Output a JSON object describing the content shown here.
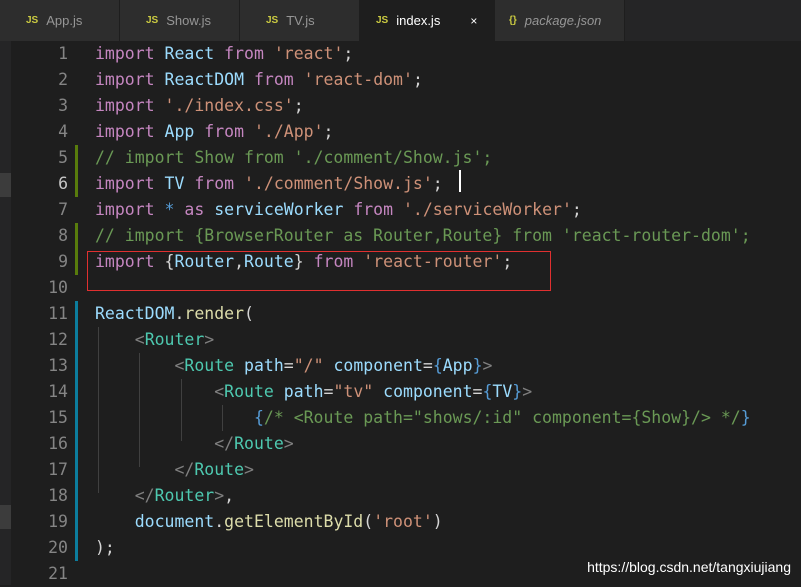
{
  "tabs": [
    {
      "icon": "JS",
      "label": "App.js"
    },
    {
      "icon": "JS",
      "label": "Show.js"
    },
    {
      "icon": "JS",
      "label": "TV.js"
    },
    {
      "icon": "JS",
      "label": "index.js",
      "close": "×"
    },
    {
      "icon": "{}",
      "label": "package.json"
    }
  ],
  "line_numbers": [
    "1",
    "2",
    "3",
    "4",
    "5",
    "6",
    "7",
    "8",
    "9",
    "10",
    "11",
    "12",
    "13",
    "14",
    "15",
    "16",
    "17",
    "18",
    "19",
    "20",
    "21"
  ],
  "code": {
    "l1": [
      "import",
      "React",
      "from",
      "'react'",
      ";"
    ],
    "l2": [
      "import",
      "ReactDOM",
      "from",
      "'react-dom'",
      ";"
    ],
    "l3": [
      "import",
      "'./index.css'",
      ";"
    ],
    "l4": [
      "import",
      "App",
      "from",
      "'./App'",
      ";"
    ],
    "l5": [
      "// import Show from './comment/Show.js';"
    ],
    "l6": [
      "import",
      "TV",
      "from",
      "'./comment/Show.js'",
      ";"
    ],
    "l7": [
      "import",
      "*",
      "as",
      "serviceWorker",
      "from",
      "'./serviceWorker'",
      ";"
    ],
    "l8": [
      "// import {BrowserRouter as Router,Route} from 'react-router-dom';"
    ],
    "l9": [
      "import",
      "{",
      "Router",
      ",",
      "Route",
      "}",
      "from",
      "'react-router'",
      ";"
    ],
    "l11": [
      "ReactDOM",
      ".",
      "render",
      "("
    ],
    "l12": [
      "<",
      "Router",
      ">"
    ],
    "l13": [
      "<",
      "Route",
      "path",
      "=",
      "\"/\"",
      "component",
      "=",
      "{",
      "App",
      "}",
      ">"
    ],
    "l14": [
      "<",
      "Route",
      "path",
      "=",
      "\"tv\"",
      "component",
      "=",
      "{",
      "TV",
      "}",
      ">"
    ],
    "l15": [
      "{",
      "/* <Route path=\"shows/:id\" component={Show}/> */",
      "}"
    ],
    "l16": [
      "</",
      "Route",
      ">"
    ],
    "l17": [
      "</",
      "Route",
      ">"
    ],
    "l18": [
      "</",
      "Router",
      ">",
      ","
    ],
    "l19": [
      "document",
      ".",
      "getElementById",
      "(",
      "'root'",
      ")"
    ],
    "l20": [
      ");"
    ]
  },
  "watermark": "https://blog.csdn.net/tangxiujiang",
  "colors": {
    "added": "#587c0c",
    "modified": "#0c7d9d",
    "highlight_box": "#e03030"
  }
}
